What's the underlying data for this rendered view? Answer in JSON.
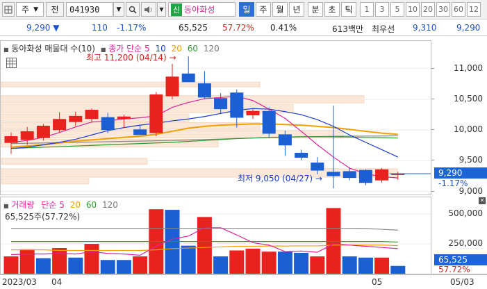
{
  "toolbar": {
    "type_value": "주",
    "jeon_label": "전",
    "symbol": "041930",
    "badge": "신",
    "stock_name": "동아화성",
    "periods": [
      "일",
      "주",
      "월",
      "년",
      "분",
      "초",
      "틱"
    ],
    "active_period": "일",
    "intervals": [
      "1",
      "3",
      "5",
      "10",
      "20",
      "30",
      "60",
      "12"
    ]
  },
  "quote": {
    "price": "9,290",
    "change": "110",
    "change_pct": "-1.17%",
    "volume": "65,525",
    "volume_ratio": "57.72%",
    "turnover_rate": "0.41%",
    "amount": "613백만",
    "pref_label": "최우선",
    "ask": "9,310",
    "bid": "9,290"
  },
  "price_panel": {
    "title": "동아화성 매물대 수(10)",
    "ma_title": "종가 단순",
    "ma_periods": [
      "5",
      "10",
      "20",
      "60",
      "120"
    ],
    "high_annotation": "최고 11,200 (04/14)",
    "low_annotation": "최저 9,050 (04/27)"
  },
  "volume_panel": {
    "title": "거래량",
    "ma_title": "단순",
    "ma_periods": [
      "5",
      "20",
      "60",
      "120"
    ],
    "current": "65,525주(57.72%)"
  },
  "axis": {
    "price_ticks": [
      "11,000",
      "10,500",
      "10,000",
      "9,500",
      "9,000"
    ],
    "price_tag": "9,290",
    "price_tag_change": "-1.17%",
    "volume_ticks": [
      "500,000",
      "250,000"
    ],
    "volume_tag": "65,525",
    "volume_tag_ratio": "57.72%"
  },
  "dates": {
    "d1": "2023/03",
    "d2": "04",
    "d3": "05",
    "d4": "05/03"
  },
  "colors": {
    "up": "#e8231f",
    "down": "#1a5fd4",
    "ma5": "#e0219a",
    "ma10": "#1a3ad0",
    "ma20": "#f0a000",
    "ma60": "#2a9c2a",
    "ma120": "#888888"
  },
  "chart_data": {
    "type": "candlestick",
    "price_range": [
      8950,
      11450
    ],
    "candles": [
      {
        "o": 9790,
        "h": 9960,
        "l": 9610,
        "c": 9900
      },
      {
        "o": 9840,
        "h": 10050,
        "l": 9760,
        "c": 9980
      },
      {
        "o": 9870,
        "h": 10100,
        "l": 9830,
        "c": 10070
      },
      {
        "o": 10000,
        "h": 10290,
        "l": 9960,
        "c": 10180
      },
      {
        "o": 10130,
        "h": 10300,
        "l": 10060,
        "c": 10230
      },
      {
        "o": 10180,
        "h": 10350,
        "l": 10130,
        "c": 10330
      },
      {
        "o": 10210,
        "h": 10280,
        "l": 9950,
        "c": 10000
      },
      {
        "o": 10180,
        "h": 10250,
        "l": 10030,
        "c": 10220
      },
      {
        "o": 10010,
        "h": 10080,
        "l": 9930,
        "c": 9920
      },
      {
        "o": 9950,
        "h": 10620,
        "l": 9900,
        "c": 10580
      },
      {
        "o": 10550,
        "h": 11080,
        "l": 10500,
        "c": 10870
      },
      {
        "o": 10920,
        "h": 11200,
        "l": 10820,
        "c": 10780
      },
      {
        "o": 10760,
        "h": 10960,
        "l": 10500,
        "c": 10530
      },
      {
        "o": 10520,
        "h": 10600,
        "l": 10260,
        "c": 10340
      },
      {
        "o": 10610,
        "h": 10660,
        "l": 10040,
        "c": 10200
      },
      {
        "o": 10240,
        "h": 10340,
        "l": 10180,
        "c": 10310
      },
      {
        "o": 10310,
        "h": 10370,
        "l": 9880,
        "c": 9940
      },
      {
        "o": 9930,
        "h": 9990,
        "l": 9580,
        "c": 9750
      },
      {
        "o": 9630,
        "h": 9680,
        "l": 9510,
        "c": 9550
      },
      {
        "o": 9470,
        "h": 9560,
        "l": 9280,
        "c": 9340
      },
      {
        "o": 9320,
        "h": 10400,
        "l": 9050,
        "c": 9250
      },
      {
        "o": 9330,
        "h": 9390,
        "l": 9180,
        "c": 9220
      },
      {
        "o": 9350,
        "h": 9360,
        "l": 9100,
        "c": 9140
      },
      {
        "o": 9180,
        "h": 9380,
        "l": 9140,
        "c": 9360
      },
      {
        "o": 9290,
        "h": 9320,
        "l": 9190,
        "c": 9290
      }
    ],
    "volume_range": [
      0,
      640000
    ],
    "volumes": [
      145000,
      205000,
      130000,
      215000,
      135000,
      250000,
      115000,
      115000,
      145000,
      540000,
      535000,
      235000,
      475000,
      145000,
      195000,
      210000,
      185000,
      185000,
      175000,
      145000,
      550000,
      145000,
      135000,
      135000,
      65525
    ],
    "volume_up": [
      true,
      true,
      false,
      true,
      false,
      true,
      false,
      false,
      true,
      true,
      false,
      false,
      true,
      false,
      true,
      true,
      true,
      false,
      false,
      true,
      true,
      false,
      false,
      true,
      false
    ],
    "volume_profile": [
      {
        "lo": 10680,
        "hi": 10780,
        "v": 0.62
      },
      {
        "lo": 10420,
        "hi": 10560,
        "v": 0.87
      },
      {
        "lo": 10260,
        "hi": 10420,
        "v": 0.7
      },
      {
        "lo": 10120,
        "hi": 10260,
        "v": 0.45
      },
      {
        "lo": 9990,
        "hi": 10120,
        "v": 0.62
      },
      {
        "lo": 9850,
        "hi": 9990,
        "v": 0.82
      },
      {
        "lo": 9700,
        "hi": 9850,
        "v": 0.52
      },
      {
        "lo": 9420,
        "hi": 9540,
        "v": 0.35
      },
      {
        "lo": 9210,
        "hi": 9370,
        "v": 0.95
      },
      {
        "lo": 9100,
        "hi": 9210,
        "v": 0.21
      }
    ],
    "ma5": [
      9800,
      9830,
      9880,
      9960,
      10050,
      10130,
      10150,
      10180,
      10200,
      10230,
      10370,
      10450,
      10510,
      10530,
      10550,
      10480,
      10340,
      10190,
      9980,
      9760,
      9560,
      9380,
      9290,
      9240,
      9220
    ],
    "ma10": [
      9700,
      9720,
      9760,
      9800,
      9850,
      9920,
      9990,
      10040,
      10080,
      10110,
      10150,
      10180,
      10220,
      10270,
      10320,
      10350,
      10340,
      10300,
      10250,
      10170,
      10060,
      9920,
      9800,
      9680,
      9560
    ],
    "ma20": [
      9720,
      9740,
      9760,
      9790,
      9820,
      9840,
      9860,
      9880,
      9900,
      9930,
      9980,
      10030,
      10060,
      10080,
      10090,
      10100,
      10100,
      10090,
      10080,
      10060,
      10040,
      10010,
      9980,
      9950,
      9930
    ],
    "ma60": [
      9700,
      9710,
      9720,
      9730,
      9740,
      9750,
      9760,
      9770,
      9780,
      9790,
      9800,
      9815,
      9830,
      9845,
      9860,
      9870,
      9880,
      9885,
      9890,
      9890,
      9890,
      9885,
      9880,
      9875,
      9870
    ],
    "ma120": [
      9780,
      9785,
      9790,
      9795,
      9800,
      9805,
      9810,
      9815,
      9820,
      9825,
      9830,
      9838,
      9846,
      9854,
      9862,
      9870,
      9878,
      9885,
      9890,
      9894,
      9898,
      9900,
      9902,
      9903,
      9905
    ],
    "vol_ma5": [
      160000,
      165000,
      165000,
      170000,
      165000,
      185000,
      170000,
      165000,
      155000,
      230000,
      290000,
      315000,
      385000,
      385000,
      325000,
      260000,
      240000,
      185000,
      190000,
      180000,
      250000,
      240000,
      230000,
      220000,
      210000
    ],
    "vol_ma20": [
      200000,
      200000,
      200000,
      195000,
      195000,
      195000,
      195000,
      195000,
      195000,
      200000,
      210000,
      215000,
      220000,
      225000,
      230000,
      230000,
      232000,
      232000,
      233000,
      233000,
      240000,
      240000,
      240000,
      240000,
      235000
    ],
    "vol_ma60": [
      270000,
      270000,
      270000,
      270000,
      270000,
      270000,
      270000,
      270000,
      270000,
      270000,
      270000,
      270000,
      270000,
      270000,
      270000,
      270000,
      270000,
      270000,
      270000,
      270000,
      270000,
      270000,
      270000,
      270000,
      265000
    ],
    "vol_ma120": [
      380000,
      380000,
      380000,
      380000,
      380000,
      380000,
      380000,
      380000,
      380000,
      380000,
      380000,
      380000,
      380000,
      380000,
      380000,
      380000,
      380000,
      380000,
      380000,
      380000,
      380000,
      380000,
      378000,
      372000,
      365000
    ]
  }
}
